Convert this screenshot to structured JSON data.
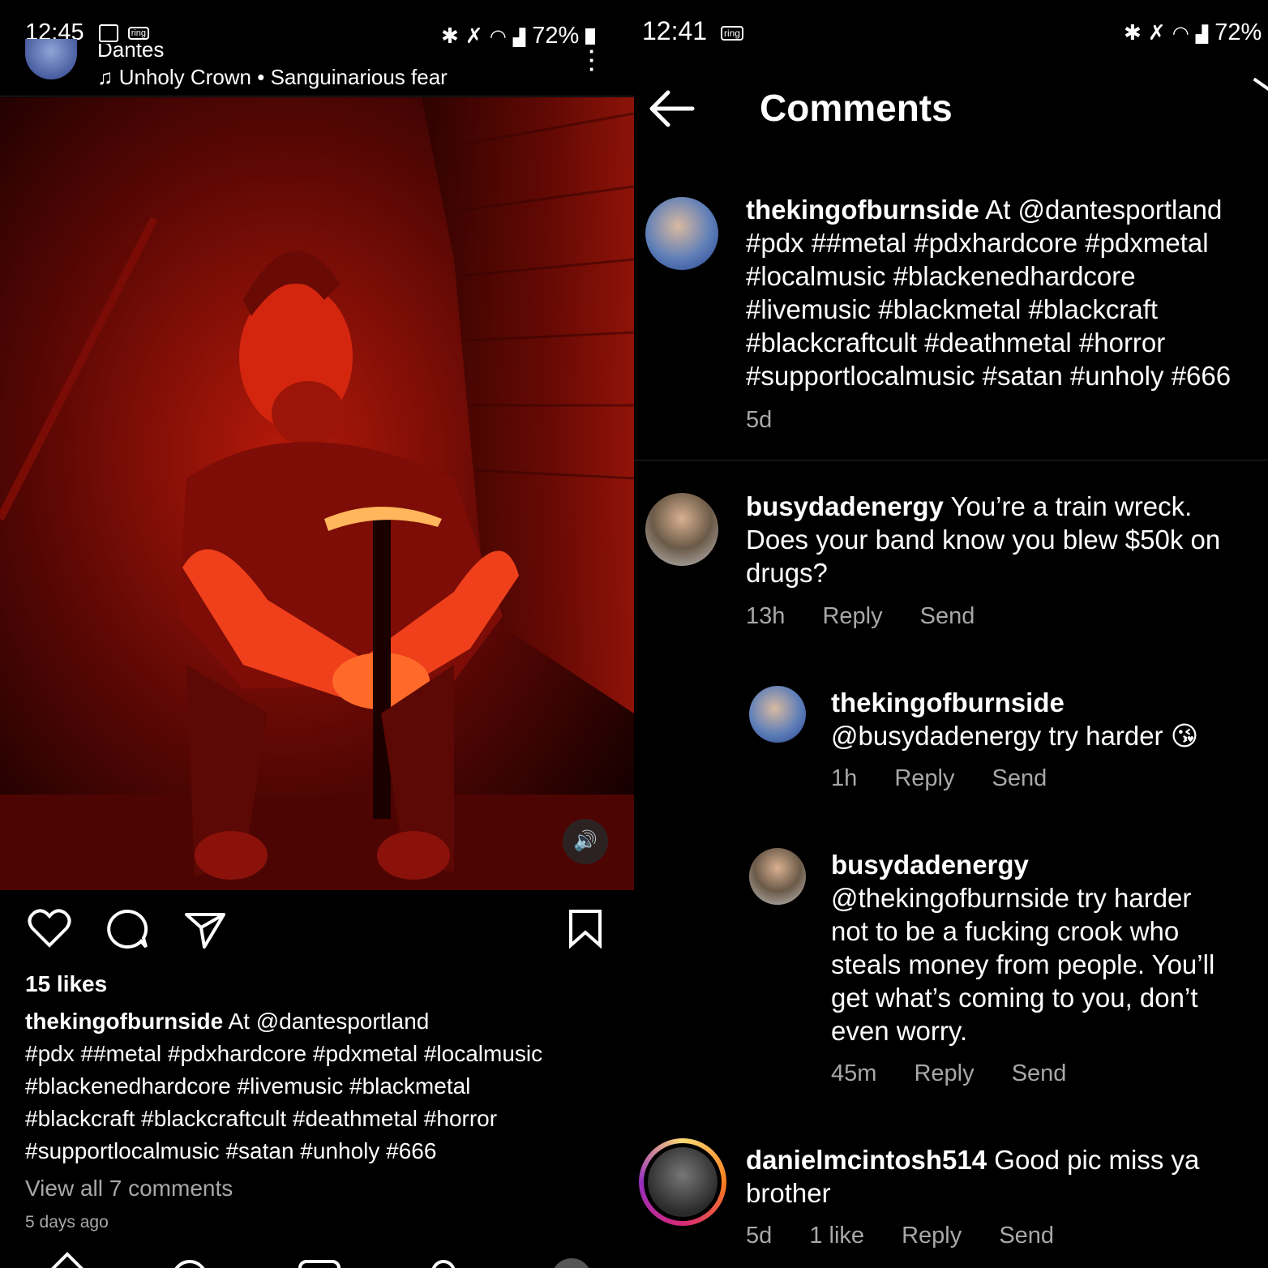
{
  "left": {
    "status": {
      "time": "12:45",
      "ring_label": "ring",
      "battery": "72%"
    },
    "header": {
      "location": "Dantes",
      "music": "Unholy Crown • Sanguinarious fear"
    },
    "post": {
      "likes": "15 likes",
      "caption_user": "thekingofburnside",
      "caption_lines": [
        " At @dantesportland",
        "#pdx ##metal #pdxhardcore #pdxmetal #localmusic",
        "#blackenedhardcore #livemusic #blackmetal",
        "#blackcraft #blackcraftcult  #deathmetal  #horror",
        "#supportlocalmusic #satan #unholy #666"
      ],
      "view_comments": "View all 7 comments",
      "time_ago": "5 days ago"
    }
  },
  "right": {
    "status": {
      "time": "12:41",
      "ring_label": "ring",
      "battery": "72%"
    },
    "title": "Comments",
    "caption": {
      "user": "thekingofburnside",
      "lines": [
        " At @dantesportland",
        "#pdx ##metal #pdxhardcore #pdxmetal",
        "#localmusic  #blackenedhardcore",
        "#livemusic #blackmetal #blackcraft",
        "#blackcraftcult  #deathmetal  #horror",
        "#supportlocalmusic #satan #unholy #666"
      ],
      "time": "5d"
    },
    "comments": [
      {
        "user": "busydadenergy",
        "lines": [
          " You’re a train wreck.",
          "Does your band know you blew $50k on",
          "drugs?"
        ],
        "time": "13h",
        "reply": "Reply",
        "send": "Send"
      },
      {
        "user": "thekingofburnside",
        "lines": [
          "@busydadenergy try harder 😘"
        ],
        "time": "1h",
        "reply": "Reply",
        "send": "Send"
      },
      {
        "user": "busydadenergy",
        "lines": [
          "@thekingofburnside try harder",
          "not to be a fucking crook who",
          "steals money from people. You’ll",
          "get what’s coming to you, don’t",
          "even worry."
        ],
        "time": "45m",
        "reply": "Reply",
        "send": "Send"
      },
      {
        "user": "danielmcintosh514",
        "lines": [
          " Good pic miss ya",
          "brother"
        ],
        "time": "5d",
        "likes": "1 like",
        "reply": "Reply",
        "send": "Send"
      }
    ]
  },
  "colors": {
    "accent_red": "#c21a0a",
    "text_muted": "#a8a8a8",
    "story_ring": "#e1306c"
  }
}
